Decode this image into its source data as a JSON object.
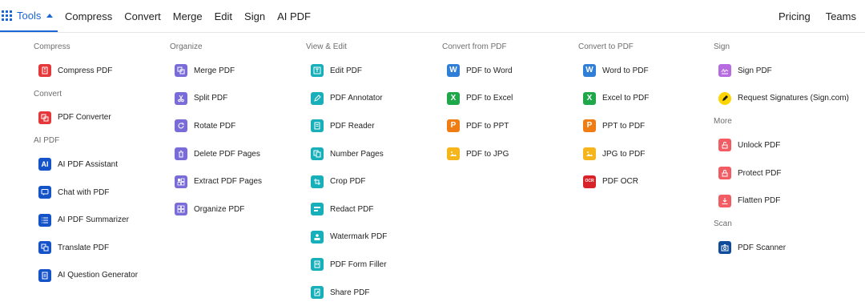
{
  "topbar": {
    "tools_label": "Tools",
    "nav_left": [
      "Compress",
      "Convert",
      "Merge",
      "Edit",
      "Sign",
      "AI PDF"
    ],
    "nav_right": [
      "Pricing",
      "Teams"
    ]
  },
  "columns": [
    {
      "sections": [
        {
          "heading": "Compress",
          "items": [
            {
              "label": "Compress PDF",
              "icon": "compress-icon",
              "color": "#e5383b"
            }
          ]
        },
        {
          "heading": "Convert",
          "items": [
            {
              "label": "PDF Converter",
              "icon": "converter-icon",
              "color": "#e5383b"
            }
          ]
        },
        {
          "heading": "AI PDF",
          "items": [
            {
              "label": "AI PDF Assistant",
              "icon": "ai-icon",
              "color": "#1553c9"
            },
            {
              "label": "Chat with PDF",
              "icon": "chat-icon",
              "color": "#1553c9"
            },
            {
              "label": "AI PDF Summarizer",
              "icon": "summarizer-icon",
              "color": "#1553c9"
            },
            {
              "label": "Translate PDF",
              "icon": "translate-icon",
              "color": "#1553c9"
            },
            {
              "label": "AI Question Generator",
              "icon": "question-icon",
              "color": "#1553c9"
            }
          ]
        }
      ]
    },
    {
      "sections": [
        {
          "heading": "Organize",
          "items": [
            {
              "label": "Merge PDF",
              "icon": "merge-icon",
              "color": "#7a6cd8"
            },
            {
              "label": "Split PDF",
              "icon": "scissors-icon",
              "color": "#7a6cd8"
            },
            {
              "label": "Rotate PDF",
              "icon": "rotate-icon",
              "color": "#7a6cd8"
            },
            {
              "label": "Delete PDF Pages",
              "icon": "trash-icon",
              "color": "#7a6cd8"
            },
            {
              "label": "Extract PDF Pages",
              "icon": "extract-icon",
              "color": "#7a6cd8"
            },
            {
              "label": "Organize PDF",
              "icon": "organize-icon",
              "color": "#7a6cd8"
            }
          ]
        }
      ]
    },
    {
      "sections": [
        {
          "heading": "View & Edit",
          "items": [
            {
              "label": "Edit PDF",
              "icon": "edit-text-icon",
              "color": "#17b0ba"
            },
            {
              "label": "PDF Annotator",
              "icon": "pen-icon",
              "color": "#17b0ba"
            },
            {
              "label": "PDF Reader",
              "icon": "reader-icon",
              "color": "#17b0ba"
            },
            {
              "label": "Number Pages",
              "icon": "number-pages-icon",
              "color": "#17b0ba"
            },
            {
              "label": "Crop PDF",
              "icon": "crop-icon",
              "color": "#17b0ba"
            },
            {
              "label": "Redact PDF",
              "icon": "redact-icon",
              "color": "#17b0ba"
            },
            {
              "label": "Watermark PDF",
              "icon": "watermark-icon",
              "color": "#17b0ba"
            },
            {
              "label": "PDF Form Filler",
              "icon": "form-icon",
              "color": "#17b0ba"
            },
            {
              "label": "Share PDF",
              "icon": "share-icon",
              "color": "#17b0ba"
            }
          ]
        }
      ]
    },
    {
      "sections": [
        {
          "heading": "Convert from PDF",
          "items": [
            {
              "label": "PDF to Word",
              "icon": "word-icon",
              "color": "#2f7ed8",
              "glyph": "W"
            },
            {
              "label": "PDF to Excel",
              "icon": "excel-icon",
              "color": "#1ea84a",
              "glyph": "X"
            },
            {
              "label": "PDF to PPT",
              "icon": "ppt-icon",
              "color": "#f07d14",
              "glyph": "P"
            },
            {
              "label": "PDF to JPG",
              "icon": "image-icon",
              "color": "#f5b51b"
            }
          ]
        }
      ]
    },
    {
      "sections": [
        {
          "heading": "Convert to PDF",
          "items": [
            {
              "label": "Word to PDF",
              "icon": "word-icon",
              "color": "#2f7ed8",
              "glyph": "W"
            },
            {
              "label": "Excel to PDF",
              "icon": "excel-icon",
              "color": "#1ea84a",
              "glyph": "X"
            },
            {
              "label": "PPT to PDF",
              "icon": "ppt-icon",
              "color": "#f07d14",
              "glyph": "P"
            },
            {
              "label": "JPG to PDF",
              "icon": "image-icon",
              "color": "#f5b51b"
            },
            {
              "label": "PDF OCR",
              "icon": "ocr-icon",
              "color": "#d9232a",
              "glyph": "OCR"
            }
          ]
        }
      ]
    },
    {
      "sections": [
        {
          "heading": "Sign",
          "items": [
            {
              "label": "Sign PDF",
              "icon": "signature-icon",
              "color": "#b66be0"
            },
            {
              "label": "Request Signatures (Sign.com)",
              "icon": "sign-com-icon",
              "color": "#ffd400"
            }
          ]
        },
        {
          "heading": "More",
          "items": [
            {
              "label": "Unlock PDF",
              "icon": "unlock-icon",
              "color": "#f25d63"
            },
            {
              "label": "Protect PDF",
              "icon": "lock-icon",
              "color": "#f25d63"
            },
            {
              "label": "Flatten PDF",
              "icon": "flatten-icon",
              "color": "#f25d63"
            }
          ]
        },
        {
          "heading": "Scan",
          "items": [
            {
              "label": "PDF Scanner",
              "icon": "camera-icon",
              "color": "#0f4c9c"
            }
          ]
        }
      ]
    }
  ]
}
